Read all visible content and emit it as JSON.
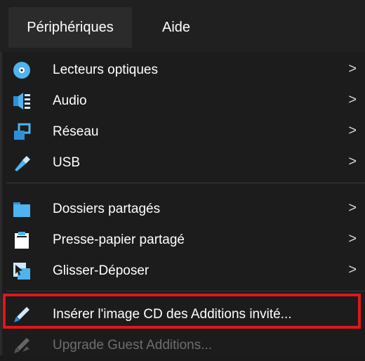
{
  "menubar": {
    "tabs": [
      {
        "label": "Périphériques"
      },
      {
        "label": "Aide"
      }
    ]
  },
  "menu": {
    "items": [
      {
        "label": "Lecteurs optiques",
        "icon": "optical-disc-icon",
        "submenu": true
      },
      {
        "label": "Audio",
        "icon": "audio-icon",
        "submenu": true
      },
      {
        "label": "Réseau",
        "icon": "network-icon",
        "submenu": true
      },
      {
        "label": "USB",
        "icon": "usb-icon",
        "submenu": true
      },
      {
        "label": "Dossiers partagés",
        "icon": "shared-folder-icon",
        "submenu": true
      },
      {
        "label": "Presse-papier partagé",
        "icon": "clipboard-icon",
        "submenu": true
      },
      {
        "label": "Glisser-Déposer",
        "icon": "drag-drop-icon",
        "submenu": true
      },
      {
        "label": "Insérer l'image CD des Additions invité...",
        "icon": "insert-cd-icon",
        "submenu": false
      },
      {
        "label": "Upgrade Guest Additions...",
        "icon": "upgrade-icon",
        "submenu": false,
        "disabled": true
      }
    ],
    "submenu_arrow": ">"
  },
  "colors": {
    "background": "#1c1c1c",
    "highlight_border": "#e0161b",
    "text": "#ffffff",
    "disabled_text": "#6e6e6e"
  }
}
